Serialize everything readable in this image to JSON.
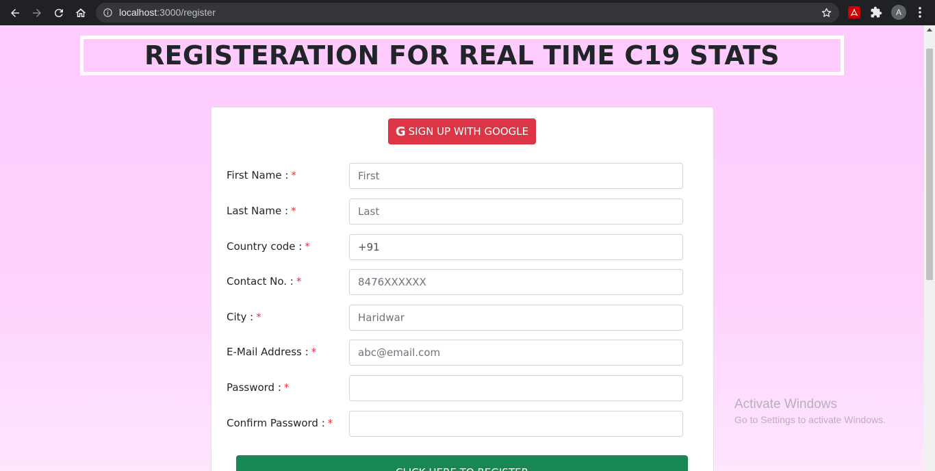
{
  "browser": {
    "url_host": "localhost",
    "url_path": ":3000/register",
    "profile_initial": "A",
    "icons": {
      "back": "arrow-left-icon",
      "forward": "arrow-right-icon",
      "reload": "reload-icon",
      "home": "home-icon",
      "info": "info-icon",
      "bookmark": "star-icon",
      "pdf_extension": "pdf-extension-icon",
      "extensions": "puzzle-icon",
      "menu": "kebab-menu-icon"
    }
  },
  "page": {
    "title": "REGISTERATION FOR REAL TIME C19 STATS",
    "background_color": "#fcd0fc"
  },
  "google_button": {
    "icon_glyph": "G",
    "label": "SIGN UP WITH GOOGLE",
    "color": "#dc3545"
  },
  "form": {
    "required_marker": "*",
    "fields": [
      {
        "label": "First Name :",
        "value": "",
        "placeholder": "First"
      },
      {
        "label": "Last Name :",
        "value": "",
        "placeholder": "Last"
      },
      {
        "label": "Country code :",
        "value": "+91",
        "placeholder": ""
      },
      {
        "label": "Contact No. :",
        "value": "",
        "placeholder": "8476XXXXXX"
      },
      {
        "label": "City :",
        "value": "",
        "placeholder": "Haridwar"
      },
      {
        "label": "E-Mail Address :",
        "value": "",
        "placeholder": "abc@email.com"
      },
      {
        "label": "Password :",
        "value": "",
        "placeholder": ""
      },
      {
        "label": "Confirm Password :",
        "value": "",
        "placeholder": ""
      }
    ],
    "submit_label": "CLICK HERE TO REGISTER",
    "submit_color": "#198754"
  },
  "watermark": {
    "line1": "Activate Windows",
    "line2": "Go to Settings to activate Windows."
  }
}
